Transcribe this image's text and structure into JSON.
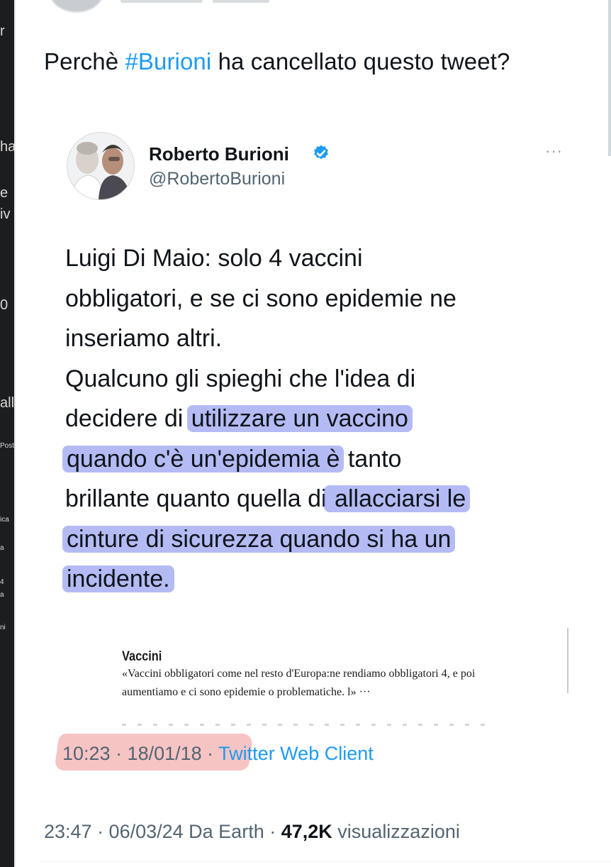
{
  "left_fragments": [
    "r",
    "ha",
    "e",
    "iv",
    "0",
    "all",
    "Post",
    "ica",
    "a",
    "4",
    "a",
    "ni"
  ],
  "tweet": {
    "text_before": "Perchè ",
    "hashtag": "#Burioni",
    "text_after": " ha cancellato questo tweet?",
    "date": "23:47 · 06/03/24 Da Earth · ",
    "views_count": "47,2K",
    "views_label": " visualizzazioni"
  },
  "quoted": {
    "name": "Roberto Burioni",
    "handle": "@RobertoBurioni",
    "more": "···",
    "body": {
      "l1": "Luigi Di Maio: solo 4 vaccini",
      "l2": "obbligatori, e se ci sono epidemie ne",
      "l3": "inseriamo altri.",
      "l4": "Qualcuno gli spieghi che l'idea di",
      "l5a": "decidere di ",
      "l5b": "utilizzare un vaccino",
      "l6a": "quando c'è un'epidemia è",
      "l6b": " tanto",
      "l7a": "brillante quanto quella di",
      "l7b": " allacciarsi le",
      "l8": "cinture di sicurezza quando si ha un",
      "l9": "incidente."
    },
    "article": {
      "title": "Vaccini",
      "line1": "«Vaccini obbligatori come nel resto d'Europa:ne rendiamo obbligatori 4, e poi",
      "line2": "aumentiamo e ci sono epidemie o problematiche. l» ···"
    },
    "meta": {
      "time": "10:23 · 18/01/18 · ",
      "client": "Twitter Web Client"
    }
  },
  "colors": {
    "link": "#1d9bf0",
    "highlight_blue": "#7684eb",
    "highlight_red": "#eb7373",
    "verified": "#1d9bf0"
  },
  "icons": [
    "verified-badge-icon",
    "more-options-icon"
  ]
}
